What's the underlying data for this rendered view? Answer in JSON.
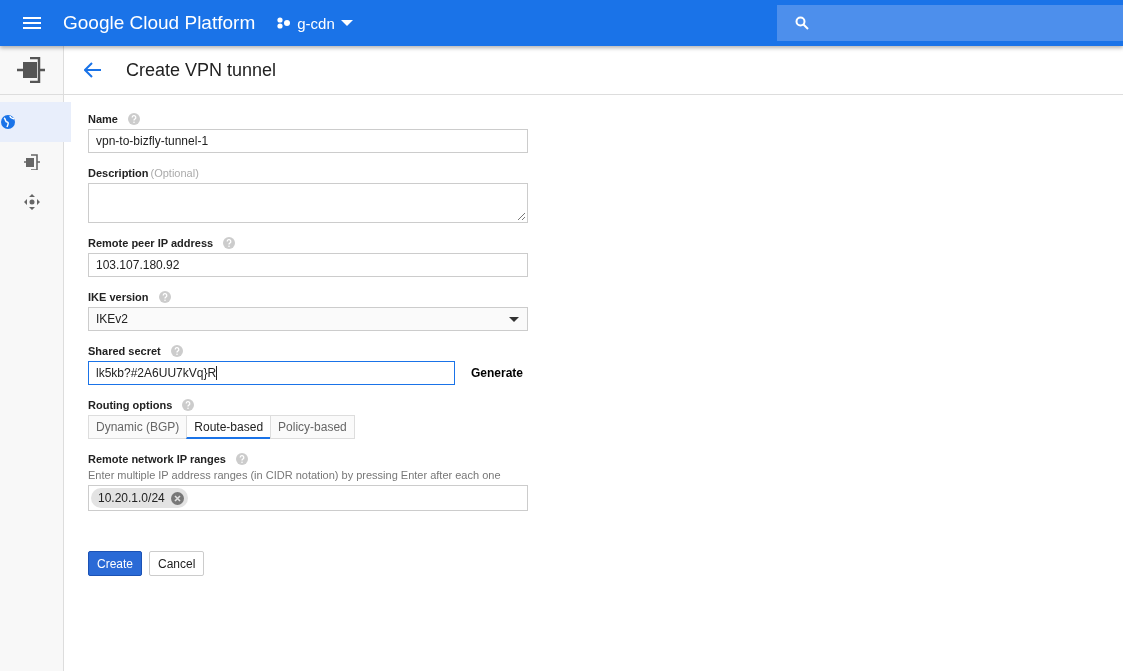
{
  "header": {
    "title": "Google Cloud Platform",
    "project": "g-cdn"
  },
  "sidebar": {
    "items": [
      {
        "kind": "globe",
        "selected": true
      },
      {
        "kind": "gateway",
        "selected": false
      },
      {
        "kind": "routes",
        "selected": false
      }
    ]
  },
  "page": {
    "title": "Create VPN tunnel"
  },
  "fields": [
    {
      "kind": "text",
      "label": "Name",
      "help": true,
      "value": "vpn-to-bizfly-tunnel-1"
    },
    {
      "kind": "textarea",
      "label": "Description",
      "optional": "(Optional)",
      "help": false
    },
    {
      "kind": "text",
      "label": "Remote peer IP address",
      "help": true,
      "value": "103.107.180.92"
    },
    {
      "kind": "select",
      "label": "IKE version",
      "help": true,
      "value": "IKEv2"
    },
    {
      "kind": "secret",
      "label": "Shared secret",
      "help": true,
      "value": "lk5kb?#2A6UU7kVq}R",
      "focused": true,
      "action": "Generate"
    },
    {
      "kind": "segmented",
      "label": "Routing options",
      "help": true,
      "options": [
        {
          "label": "Dynamic (BGP)",
          "selected": false
        },
        {
          "label": "Route-based",
          "selected": true
        },
        {
          "label": "Policy-based",
          "selected": false
        }
      ]
    },
    {
      "kind": "tags",
      "label": "Remote network IP ranges",
      "help": true,
      "hint": "Enter multiple IP address ranges (in CIDR notation) by pressing Enter after each one",
      "tags": [
        "10.20.1.0/24"
      ]
    }
  ],
  "buttons": [
    {
      "label": "Create",
      "kind": "primary"
    },
    {
      "label": "Cancel",
      "kind": "secondary"
    }
  ]
}
